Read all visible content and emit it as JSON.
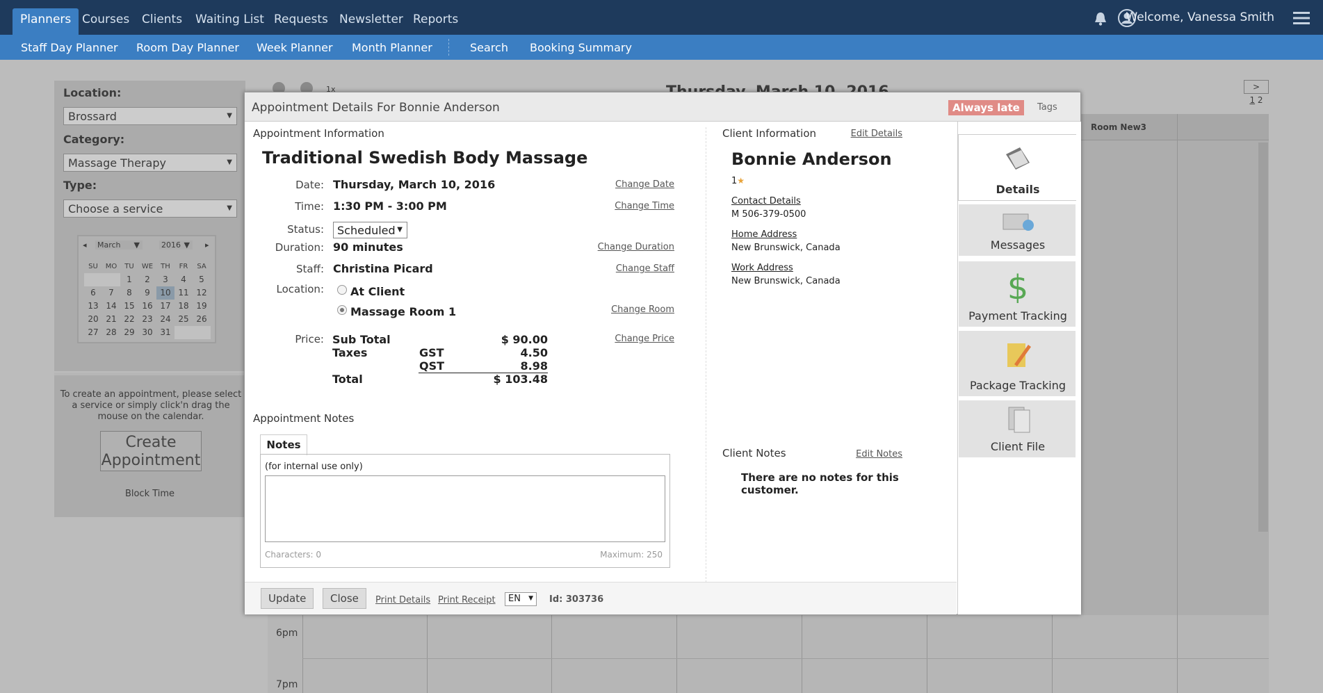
{
  "topnav": {
    "tabs": [
      "Planners",
      "Courses",
      "Clients",
      "Waiting List",
      "Requests",
      "Newsletter",
      "Reports"
    ],
    "welcome": "Welcome, Vanessa Smith"
  },
  "subnav": {
    "items": [
      "Staff Day Planner",
      "Room Day Planner",
      "Week Planner",
      "Month Planner",
      "Search",
      "Booking Summary"
    ]
  },
  "sidebar": {
    "location_label": "Location:",
    "location_value": "Brossard",
    "category_label": "Category:",
    "category_value": "Massage Therapy",
    "type_label": "Type:",
    "type_value": "Choose a service",
    "cal_month": "March",
    "cal_year": "2016",
    "cal_days": [
      "SU",
      "MO",
      "TU",
      "WE",
      "TH",
      "FR",
      "SA"
    ],
    "cal_weeks": [
      [
        "",
        "",
        "1",
        "2",
        "3",
        "4",
        "5"
      ],
      [
        "6",
        "7",
        "8",
        "9",
        "10",
        "11",
        "12"
      ],
      [
        "13",
        "14",
        "15",
        "16",
        "17",
        "18",
        "19"
      ],
      [
        "20",
        "21",
        "22",
        "23",
        "24",
        "25",
        "26"
      ],
      [
        "27",
        "28",
        "29",
        "30",
        "31",
        "",
        ""
      ]
    ],
    "today": "10",
    "help_text": "To create an appointment, please select a service or simply click'n drag the mouse on the calendar.",
    "create_line1": "Create",
    "create_line2": "Appointment",
    "block_time": "Block Time"
  },
  "calendar": {
    "zoom": "1x",
    "date_heading": "Thursday, March 10, 2016",
    "room_header": "Room New3",
    "pager_next": ">",
    "page1": "1",
    "page2": "2",
    "time_6pm": "6pm",
    "time_7pm": "7pm"
  },
  "modal": {
    "title": "Appointment Details For Bonnie Anderson",
    "badge": "Always late",
    "tags": "Tags",
    "appt_section": "Appointment Information",
    "service": "Traditional Swedish Body Massage",
    "date_label": "Date:",
    "date_value": "Thursday, March 10, 2016",
    "change_date": "Change Date",
    "time_label": "Time:",
    "time_value": "1:30 PM - 3:00 PM",
    "change_time": "Change Time",
    "status_label": "Status:",
    "status_value": "Scheduled",
    "duration_label": "Duration:",
    "duration_value": "90 minutes",
    "change_duration": "Change Duration",
    "staff_label": "Staff:",
    "staff_value": "Christina Picard",
    "change_staff": "Change Staff",
    "location_label": "Location:",
    "loc_option1": "At Client",
    "loc_option2": "Massage Room 1",
    "change_room": "Change Room",
    "price_label": "Price:",
    "subtotal_label": "Sub Total",
    "subtotal_value": "$ 90.00",
    "taxes_label": "Taxes",
    "gst_label": "GST",
    "gst_value": "4.50",
    "qst_label": "QST",
    "qst_value": "8.98",
    "total_label": "Total",
    "total_value": "$ 103.48",
    "change_price": "Change Price",
    "notes_section": "Appointment Notes",
    "notes_tab": "Notes",
    "notes_hint": "(for internal use only)",
    "chars": "Characters: 0",
    "maximum": "Maximum: 250",
    "client_section": "Client Information",
    "edit_details": "Edit Details",
    "client_name": "Bonnie Anderson",
    "client_stars": "1",
    "contact_details": "Contact Details",
    "phone": "M 506-379-0500",
    "home_address": "Home Address",
    "home_value": "New Brunswick, Canada",
    "work_address": "Work Address",
    "work_value": "New Brunswick, Canada",
    "client_notes": "Client Notes",
    "edit_notes": "Edit Notes",
    "no_notes": "There are no notes for this customer.",
    "update": "Update",
    "close": "Close",
    "print_details": "Print Details",
    "print_receipt": "Print Receipt",
    "lang": "EN",
    "id": "Id: 303736",
    "tabs": [
      "Details",
      "Messages",
      "Payment Tracking",
      "Package Tracking",
      "Client File"
    ]
  }
}
